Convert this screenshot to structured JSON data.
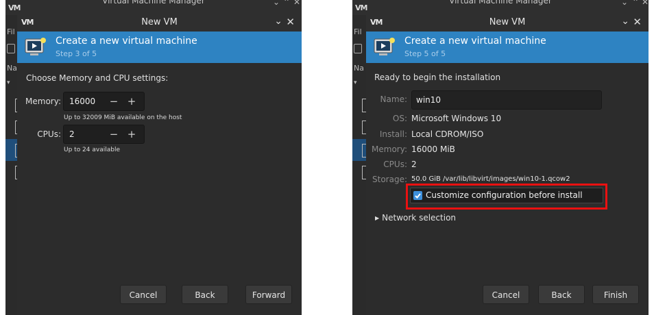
{
  "colors": {
    "banner": "#2e83c2",
    "highlight": "#ea1111",
    "checkbox": "#3d8fdb",
    "window_bg": "#2c2c2c"
  },
  "left": {
    "bg_window": {
      "logo": "VM",
      "title": "Virtual Machine Manager",
      "menu_fragment": "Fil",
      "list_fragment": "Na"
    },
    "dialog": {
      "logo": "VM",
      "title": "New VM",
      "minimize_icon": "chevron-down-icon",
      "close_icon": "close-icon",
      "banner_title": "Create a new virtual machine",
      "banner_subtitle": "Step 3 of 5",
      "heading": "Choose Memory and CPU settings:",
      "memory_label": "Memory:",
      "memory_value": "16000",
      "memory_hint": "Up to 32009 MiB available on the host",
      "cpus_label": "CPUs:",
      "cpus_value": "2",
      "cpus_hint": "Up to 24 available",
      "minus": "−",
      "plus": "+",
      "buttons": {
        "cancel": "Cancel",
        "back": "Back",
        "forward": "Forward"
      }
    }
  },
  "right": {
    "bg_window": {
      "logo": "VM",
      "title": "Virtual Machine Manager",
      "menu_fragment": "Fil",
      "list_fragment": "Na"
    },
    "dialog": {
      "logo": "VM",
      "title": "New VM",
      "minimize_icon": "chevron-down-icon",
      "close_icon": "close-icon",
      "banner_title": "Create a new virtual machine",
      "banner_subtitle": "Step 5 of 5",
      "heading": "Ready to begin the installation",
      "name_label": "Name:",
      "name_value": "win10",
      "os_label": "OS:",
      "os_value": "Microsoft Windows 10",
      "install_label": "Install:",
      "install_value": "Local CDROM/ISO",
      "memory_label": "Memory:",
      "memory_value": "16000 MiB",
      "cpus_label": "CPUs:",
      "cpus_value": "2",
      "storage_label": "Storage:",
      "storage_value": "50.0 GiB /var/lib/libvirt/images/win10-1.qcow2",
      "customize_label": "Customize configuration before install",
      "customize_checked": true,
      "network_label": "Network selection",
      "buttons": {
        "cancel": "Cancel",
        "back": "Back",
        "finish": "Finish"
      }
    }
  }
}
